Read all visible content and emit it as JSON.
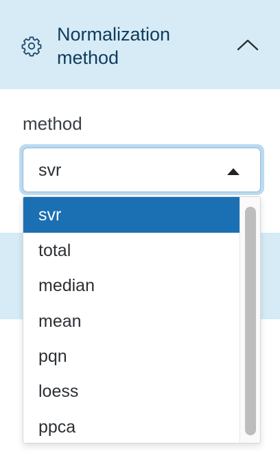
{
  "panel": {
    "title": "Normalization method",
    "header_icon": "gear-icon",
    "collapse_icon": "chevron-up-icon"
  },
  "field": {
    "label": "method",
    "selected_value": "svr"
  },
  "dropdown": {
    "options": [
      "svr",
      "total",
      "median",
      "mean",
      "pqn",
      "loess",
      "ppca"
    ],
    "highlighted_index": 0
  },
  "colors": {
    "header_bg": "#d6ebf6",
    "selected_bg": "#1b6fb3",
    "focus_ring": "#bcdaf0"
  }
}
